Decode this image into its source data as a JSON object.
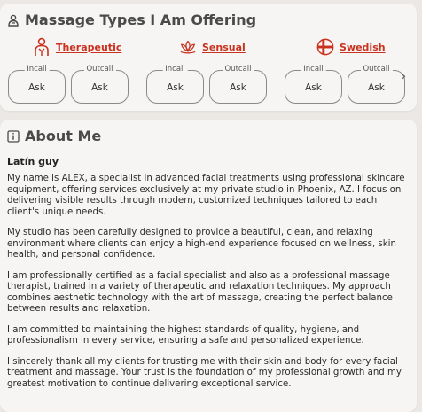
{
  "services": {
    "title": "Massage Types I Am Offering",
    "types": [
      {
        "label": "Therapeutic",
        "icon": "therapist-icon"
      },
      {
        "label": "Sensual",
        "icon": "lotus-icon"
      },
      {
        "label": "Swedish",
        "icon": "swedish-cross-icon"
      }
    ],
    "boxes": [
      {
        "legend": "Incall",
        "value": "Ask"
      },
      {
        "legend": "Outcall",
        "value": "Ask"
      },
      {
        "legend": "Incall",
        "value": "Ask"
      },
      {
        "legend": "Outcall",
        "value": "Ask"
      },
      {
        "legend": "Incall",
        "value": "Ask"
      },
      {
        "legend": "Outcall",
        "value": "Ask"
      }
    ],
    "next_symbol": "›"
  },
  "about": {
    "title": "About Me",
    "name": "Latín guy",
    "paragraphs": [
      "My name is ALEX, a specialist in advanced facial treatments using professional skincare equipment, offering services exclusively at my private studio in Phoenix, AZ. I focus on delivering visible results through modern, customized techniques tailored to each client's unique needs.",
      "My studio has been carefully designed to provide a beautiful, clean, and relaxing environment where clients can enjoy a high-end experience focused on wellness, skin health, and personal confidence.",
      "I am professionally certified as a facial specialist and also as a professional massage therapist, trained in a variety of therapeutic and relaxation techniques. My approach combines aesthetic technology with the art of massage, creating the perfect balance between results and relaxation.",
      "I am committed to maintaining the highest standards of quality, hygiene, and professionalism in every service, ensuring a safe and personalized experience.",
      "I sincerely thank all my clients for trusting me with their skin and body for every facial treatment and massage. Your trust is the foundation of my professional growth and my greatest motivation to continue delivering exceptional service."
    ]
  },
  "colors": {
    "accent": "#c8321f",
    "background": "#ece8e5",
    "card": "#f7f5f3"
  }
}
